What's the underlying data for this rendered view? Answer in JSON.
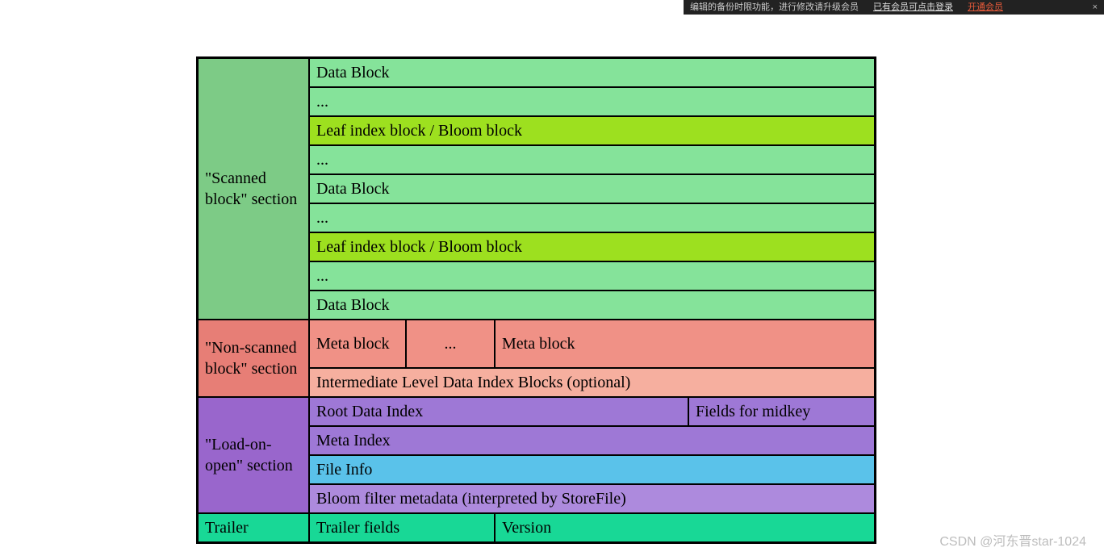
{
  "topbar": {
    "text1": "编辑的备份时限功能，进行修改请升级会员",
    "link1": "已有会员可点击登录",
    "link2": "开通会员",
    "close": "×"
  },
  "sections": {
    "scanned": {
      "label": "\"Scanned block\" section",
      "rows": [
        "Data Block",
        "...",
        "Leaf index block / Bloom block",
        "...",
        "Data Block",
        "...",
        "Leaf index block / Bloom block",
        "...",
        "Data Block"
      ]
    },
    "nonscanned": {
      "label": "\"Non-scanned block\" section",
      "meta": [
        "Meta block",
        "...",
        "Meta block"
      ],
      "intermediate": "Intermediate Level Data Index Blocks (optional)"
    },
    "load": {
      "label": "\"Load-on-open\" section",
      "rootIndex": "Root Data Index",
      "fieldsMidkey": "Fields for midkey",
      "metaIndex": "Meta Index",
      "fileInfo": "File Info",
      "bloom": "Bloom filter metadata (interpreted by StoreFile)"
    },
    "trailer": {
      "label": "Trailer",
      "fields": "Trailer fields",
      "version": "Version"
    }
  },
  "watermark": "CSDN @河东晋star-1024"
}
